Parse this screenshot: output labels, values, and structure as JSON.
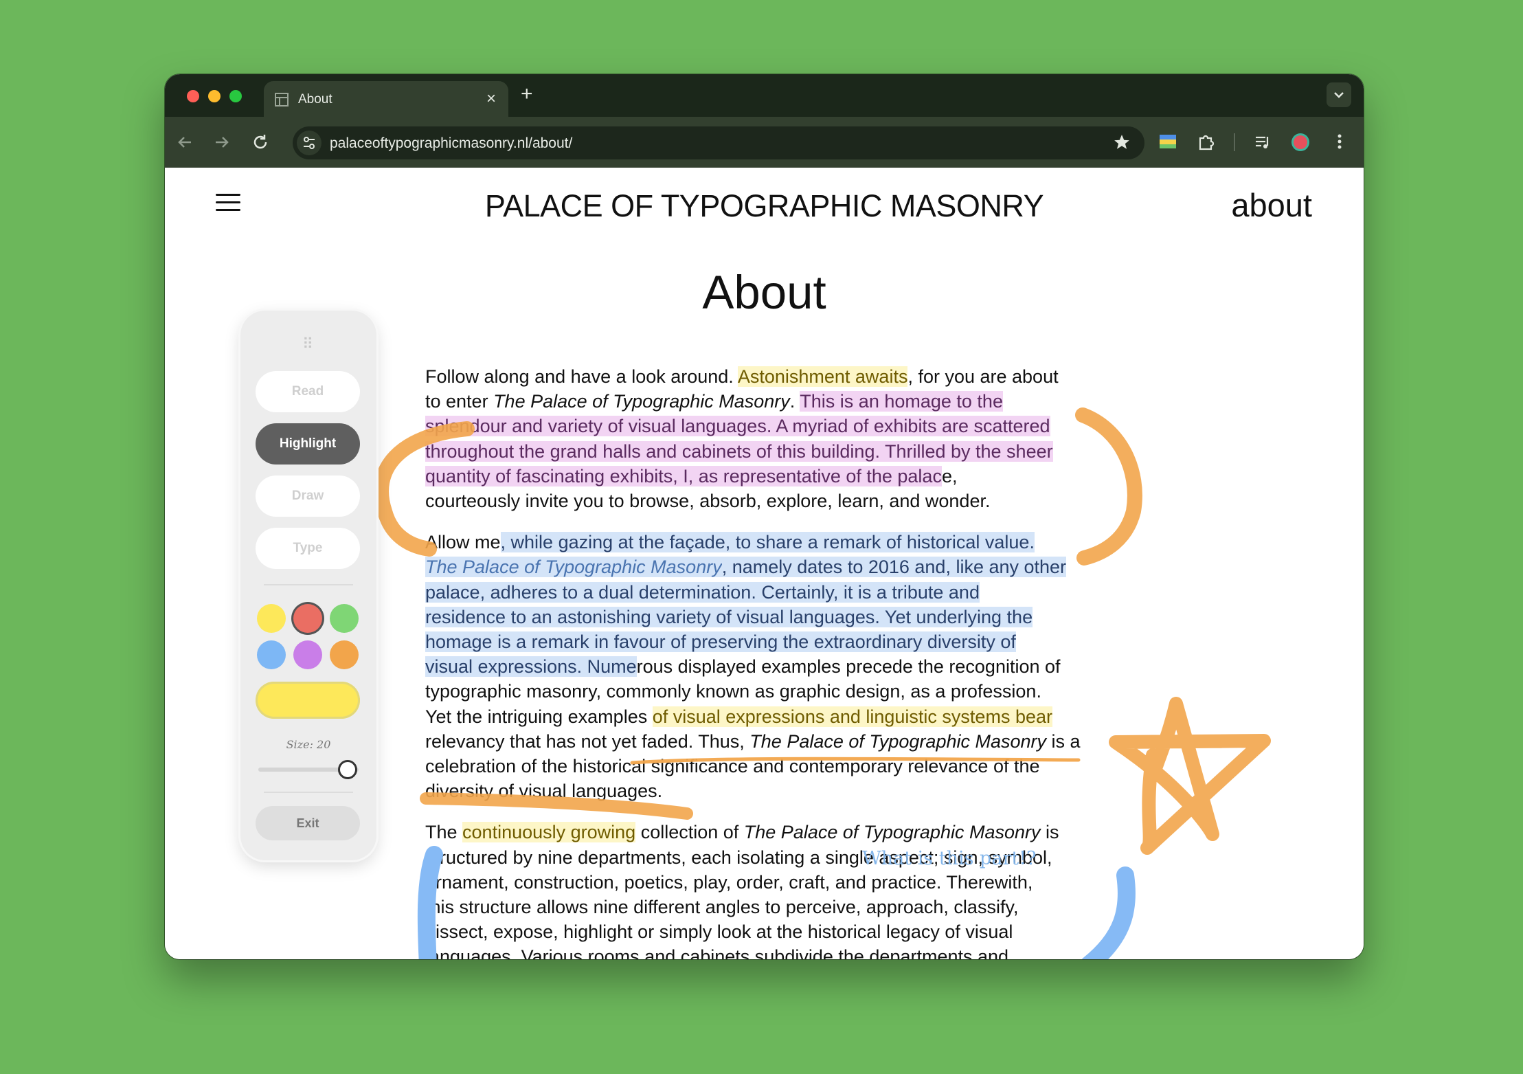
{
  "browser": {
    "tab_title": "About",
    "tab_close": "×",
    "new_tab": "+",
    "url": "palaceoftypographicmasonry.nl/about/"
  },
  "icons": [
    "back-icon",
    "forward-icon",
    "reload-icon",
    "site-settings-icon",
    "bookmark-star-icon",
    "extension-icon",
    "puzzle-icon",
    "media-icon",
    "profile-icon",
    "menu-dots-icon",
    "hamburger-icon"
  ],
  "site": {
    "title": "PALACE OF TYPOGRAPHIC MASONRY",
    "nav_link": "about",
    "heading": "About"
  },
  "article": {
    "p1": {
      "a": "Follow along and have a look around. ",
      "b": "Astonishment awaits",
      "c": ", for you are about\nto enter ",
      "d": "The Palace of Typographic Masonry",
      "e": ". ",
      "f": "This is an homage to the\nsplendour and variety of visual languages. A myriad of exhibits are scattered\nthroughout the grand halls and cabinets of this building. Thrilled by the sheer\nquantity of fascinating exhibits, I, as representative of the palac",
      "g": "e,\ncourteously invite you to browse, absorb, explore, learn, and wonder."
    },
    "p2": {
      "a": "Allow me",
      "b": ", while gazing at the façade, to share a remark of historical value.\n",
      "c": "The Palace of Typographic Masonry",
      "d": ", namely dates to 2016 and, like any other\npalace, adheres to a dual determination. Certainly, it is a tribute and\nresidence to an astonishing variety of visual languages. Yet underlying the\nhomage is a remark in favour of preserving the extraordinary diversity of\nvisual expressions. Nume",
      "e": "rous displayed examples precede the recognition of\ntypographic masonry, commonly known as graphic design, as a profession.\nYet the intriguing examples ",
      "f": "of visual expressions and linguistic systems bear",
      "g": "\nrelevancy that has not yet faded. Thus, ",
      "h": "The Palace of Typographic Masonry",
      "i": " is a\ncelebration of the historical significance and contemporary relevance of the\ndiversity of visual languages."
    },
    "p3": {
      "a": "The ",
      "b": "continuously growing",
      "c": " collection of ",
      "d": "The Palace of Typographic Masonry",
      "e": " is\nstructured by nine departments, each isolating a single aspect; sign, symbol,\nornament, construction, poetics, play, order, craft, and practice. Therewith,\nthis structure allows nine different angles to perceive, approach, classify,\ndissect, expose, highlight or simply look at the historical legacy of visual\nlanguages. Various rooms and cabinets subdivide the departments and"
    },
    "note": "What is this part!?"
  },
  "tool_panel": {
    "grip": "⠿",
    "buttons": [
      "Read",
      "Highlight",
      "Draw",
      "Type"
    ],
    "active_button": "Highlight",
    "swatch_colors": [
      "#fde85a",
      "#ea6e63",
      "#7fd675",
      "#7db7f5",
      "#c97ee8",
      "#f2a54b"
    ],
    "selected_color": "#ea6e63",
    "preview_color": "#fde85a",
    "size_label": "Size: 20",
    "size_value": 20,
    "exit_label": "Exit"
  },
  "colors": {
    "background": "#6cb75b",
    "orange_ink": "#f2a54b",
    "blue_ink": "#86baf5"
  }
}
